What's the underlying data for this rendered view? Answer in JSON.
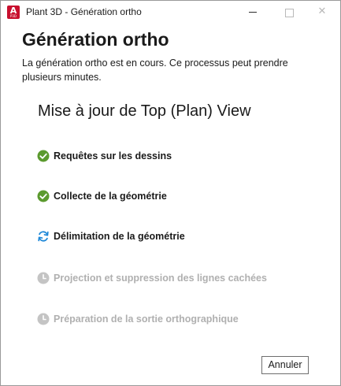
{
  "window": {
    "title": "Plant 3D - Génération ortho",
    "app_icon_letter": "A",
    "app_icon_sub": "P3D"
  },
  "dialog": {
    "heading": "Génération ortho",
    "description": "La génération ortho est en cours. Ce processus peut prendre plusieurs minutes.",
    "subheading": "Mise à jour de Top (Plan) View",
    "steps": [
      {
        "label": "Requêtes sur les dessins",
        "status": "done",
        "icon": "check-circle-icon"
      },
      {
        "label": "Collecte de la géométrie",
        "status": "done",
        "icon": "check-circle-icon"
      },
      {
        "label": "Délimitation de la géométrie",
        "status": "active",
        "icon": "refresh-icon"
      },
      {
        "label": "Projection et suppression des lignes cachées",
        "status": "pending",
        "icon": "clock-icon"
      },
      {
        "label": "Préparation de la sortie orthographique",
        "status": "pending",
        "icon": "clock-icon"
      }
    ],
    "cancel_label": "Annuler"
  },
  "colors": {
    "done": "#5b9a2e",
    "active": "#1e88d8",
    "pending": "#c4c4c4"
  }
}
